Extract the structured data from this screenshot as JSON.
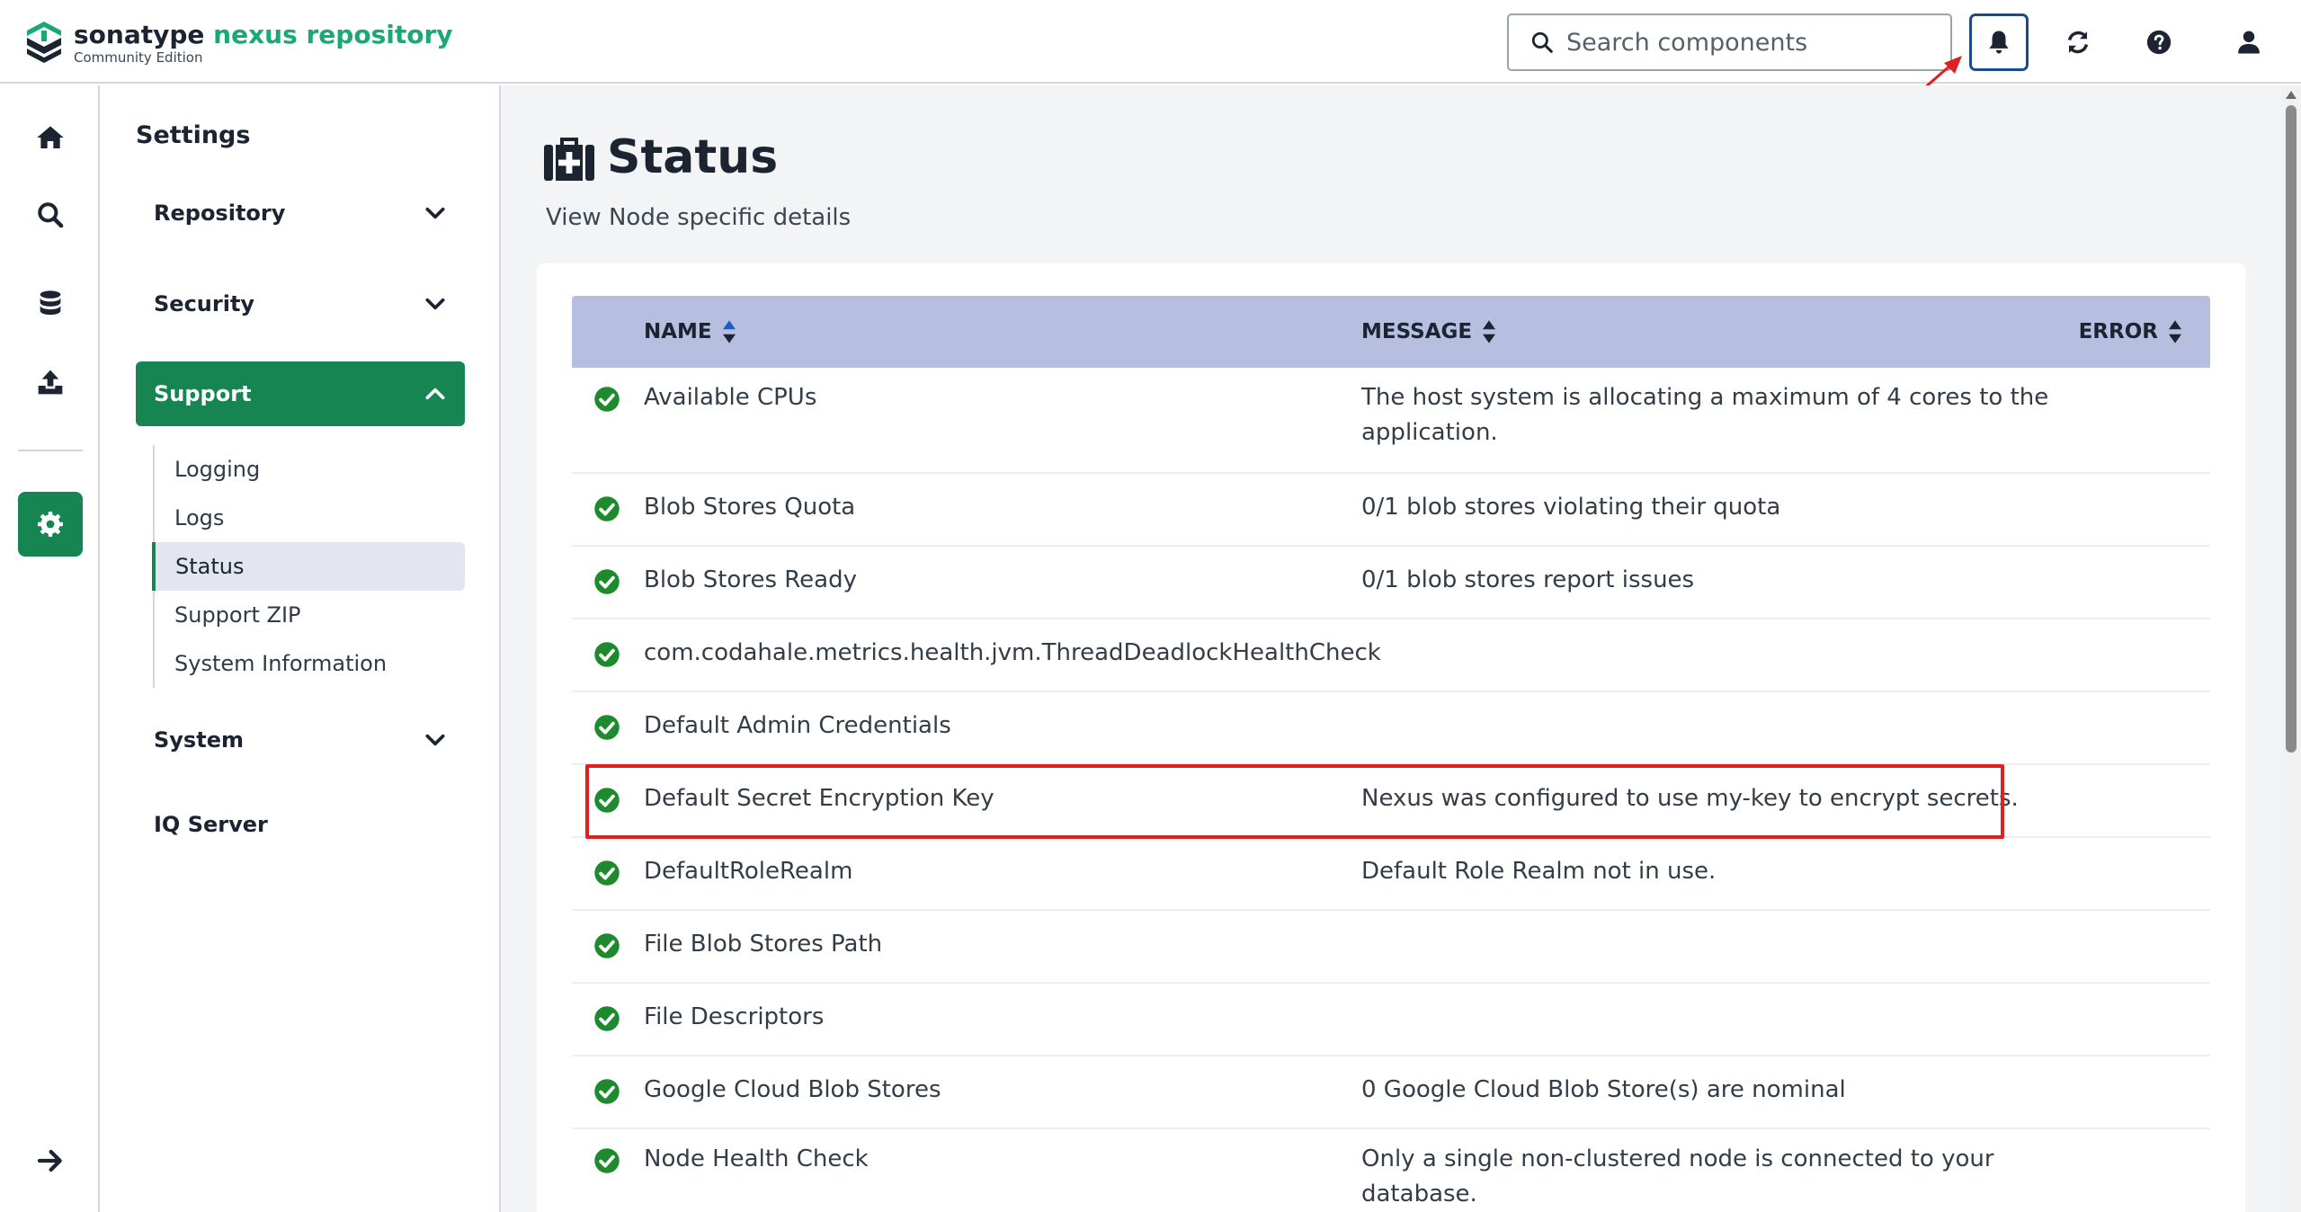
{
  "header": {
    "logo_brand_a": "sonatype",
    "logo_brand_b": "nexus repository",
    "logo_edition": "Community Edition",
    "search_placeholder": "Search components",
    "icons": [
      "bell-icon",
      "refresh-icon",
      "help-icon",
      "user-icon"
    ]
  },
  "rail": {
    "icons": [
      "home-icon",
      "search-icon",
      "database-icon",
      "upload-icon",
      "settings-gear-icon",
      "expand-arrow-icon"
    ],
    "active": "settings-gear-icon"
  },
  "sidebar": {
    "title": "Settings",
    "sections": [
      {
        "label": "Repository",
        "expanded": false
      },
      {
        "label": "Security",
        "expanded": false
      },
      {
        "label": "Support",
        "expanded": true
      }
    ],
    "support_items": [
      "Logging",
      "Logs",
      "Status",
      "Support ZIP",
      "System Information"
    ],
    "active_item": "Status",
    "system_label": "System",
    "iq_label": "IQ Server"
  },
  "main": {
    "title": "Status",
    "subtitle": "View Node specific details",
    "columns": [
      "NAME",
      "MESSAGE",
      "ERROR"
    ],
    "rows": [
      {
        "name": "Available CPUs",
        "message": "The host system is allocating a maximum of 4 cores to the application.",
        "status": "ok"
      },
      {
        "name": "Blob Stores Quota",
        "message": "0/1 blob stores violating their quota",
        "status": "ok"
      },
      {
        "name": "Blob Stores Ready",
        "message": "0/1 blob stores report issues",
        "status": "ok"
      },
      {
        "name": "com.codahale.metrics.health.jvm.ThreadDeadlockHealthCheck",
        "message": "",
        "status": "ok"
      },
      {
        "name": "Default Admin Credentials",
        "message": "",
        "status": "ok"
      },
      {
        "name": "Default Secret Encryption Key",
        "message": "Nexus was configured to use my-key to encrypt secrets.",
        "status": "ok"
      },
      {
        "name": "DefaultRoleRealm",
        "message": "Default Role Realm not in use.",
        "status": "ok"
      },
      {
        "name": "File Blob Stores Path",
        "message": "",
        "status": "ok"
      },
      {
        "name": "File Descriptors",
        "message": "",
        "status": "ok"
      },
      {
        "name": "Google Cloud Blob Stores",
        "message": "0 Google Cloud Blob Store(s) are nominal",
        "status": "ok"
      },
      {
        "name": "Node Health Check",
        "message": "Only a single non-clustered node is connected to your database.",
        "status": "ok"
      }
    ]
  },
  "colors": {
    "accent_green": "#168552",
    "brand_green": "#19a974",
    "table_header": "#b6bfdf",
    "check_green": "#1e8a2e",
    "annotation_red": "#e02020",
    "bell_border": "#1a4b8c"
  }
}
